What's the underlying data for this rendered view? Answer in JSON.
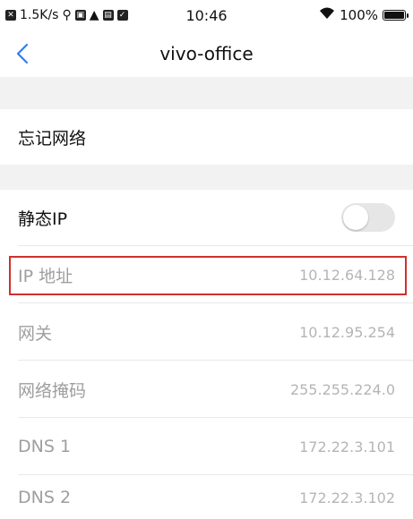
{
  "status_bar": {
    "speed": "1.5K/s",
    "time": "10:46",
    "battery": "100%",
    "battery_level": 1.0
  },
  "nav": {
    "title": "vivo-office"
  },
  "actions": {
    "forget_network": "忘记网络"
  },
  "static_ip": {
    "label": "静态IP",
    "enabled": false
  },
  "fields": [
    {
      "label": "IP 地址",
      "value": "10.12.64.128"
    },
    {
      "label": "网关",
      "value": "10.12.95.254"
    },
    {
      "label": "网络掩码",
      "value": "255.255.224.0"
    },
    {
      "label": "DNS 1",
      "value": "172.22.3.101"
    },
    {
      "label": "DNS 2",
      "value": "172.22.3.102"
    }
  ],
  "colors": {
    "accent": "#2f7cf6",
    "highlight": "#d0302f"
  }
}
